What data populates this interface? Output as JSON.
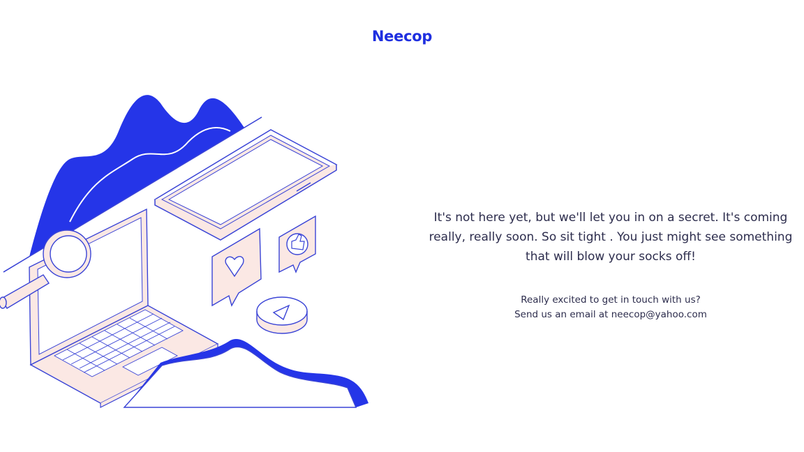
{
  "header": {
    "brand": "Neecop"
  },
  "main": {
    "headline_line1": "It's not here yet, but we'll let you in on a secret. It's coming",
    "headline_line2": "really, really soon. So sit tight . You just might see something",
    "headline_line3": "that will blow your socks off!",
    "contact_line1": "Really excited to get in touch with us?",
    "contact_line2": "Send us an email at neecop@yahoo.com"
  },
  "colors": {
    "brand": "#1f2fe0",
    "accent": "#2535e8",
    "line": "#3a44d6",
    "fill_pink": "#fbe8e4",
    "text": "#2d2d4d",
    "background": "#ffffff"
  },
  "icons": [
    "magnifier-icon",
    "heart-icon",
    "thumbs-up-icon",
    "play-icon",
    "laptop-illustration",
    "phone-illustration"
  ]
}
